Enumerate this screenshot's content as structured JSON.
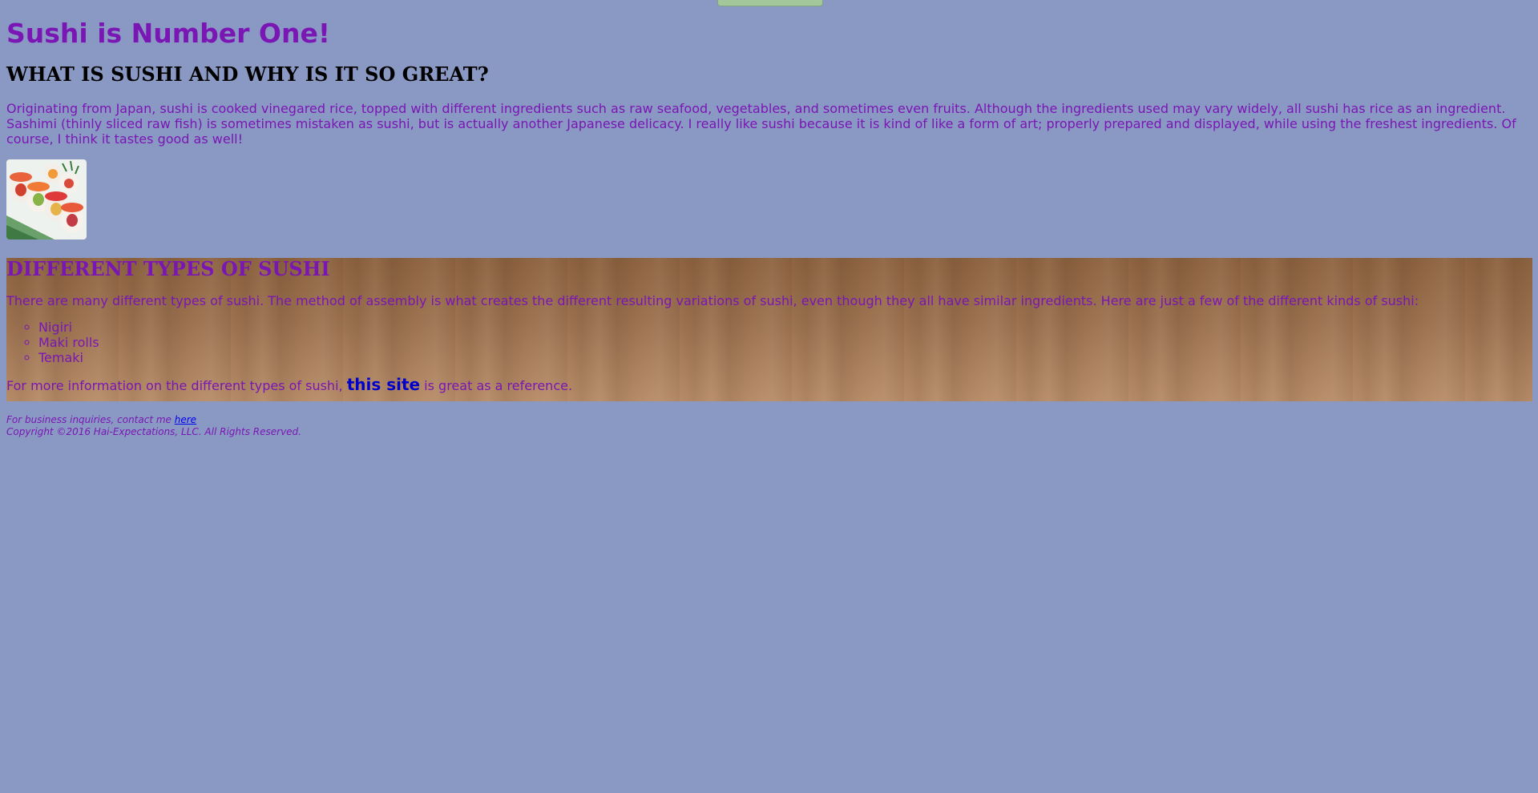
{
  "page": {
    "title": "Sushi is Number One!"
  },
  "intro_section": {
    "heading": "WHAT IS SUSHI AND WHY IS IT SO GREAT?",
    "paragraph": "Originating from Japan, sushi is cooked vinegared rice, topped with different ingredients such as raw seafood, vegetables, and sometimes even fruits. Although the ingredients used may vary widely, all sushi has rice as an ingredient. Sashimi (thinly sliced raw fish) is sometimes mistaken as sushi, but is actually another Japanese delicacy. I really like sushi because it is kind of like a form of art; properly prepared and displayed, while using the freshest ingredients. Of course, I think it tastes good as well!"
  },
  "types_section": {
    "heading": "DIFFERENT TYPES OF SUSHI",
    "paragraph": "There are many different types of sushi. The method of assembly is what creates the different resulting variations of sushi, even though they all have similar ingredients. Here are just a few of the different kinds of sushi:",
    "list": [
      "Nigiri",
      "Maki rolls",
      "Temaki"
    ],
    "more_info_prefix": "For more information on the different types of sushi, ",
    "more_info_link": "this site",
    "more_info_suffix": " is great as a reference."
  },
  "footer": {
    "contact_prefix": "For business inquiries, contact me ",
    "contact_link": "here",
    "copyright": "Copyright ©2016 Hai-Expectations, LLC. All Rights Reserved."
  },
  "colors": {
    "background": "#8a99c4",
    "text_purple": "#7a16b3",
    "link_blue": "#0000cc"
  }
}
